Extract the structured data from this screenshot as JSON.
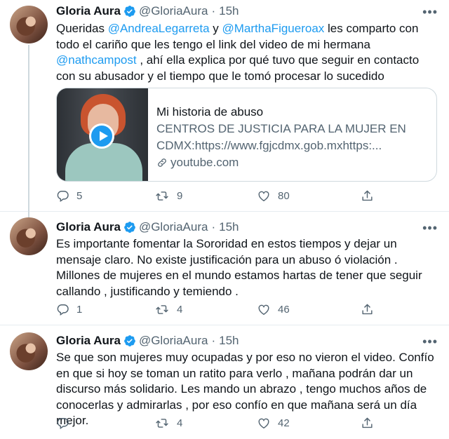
{
  "accent_color": "#1d9bf0",
  "tweets": [
    {
      "display_name": "Gloria Aura",
      "handle": "@GloriaAura",
      "separator": "·",
      "time": "15h",
      "text_segments": [
        {
          "type": "text",
          "value": "Queridas "
        },
        {
          "type": "mention",
          "value": "@AndreaLegarreta"
        },
        {
          "type": "text",
          "value": " y "
        },
        {
          "type": "mention",
          "value": "@MarthaFigueroax"
        },
        {
          "type": "text",
          "value": " les comparto con todo el cariño que les tengo el link del video de mi hermana "
        },
        {
          "type": "mention",
          "value": "@nathcampost"
        },
        {
          "type": "text",
          "value": " , ahí ella explica por qué tuvo que seguir en contacto con su abusador y el tiempo que le tomó procesar lo sucedido"
        }
      ],
      "card": {
        "title": "Mi historia de abuso",
        "description": "CENTROS DE JUSTICIA PARA LA MUJER EN CDMX:https://www.fgjcdmx.gob.mxhttps:...",
        "domain": "youtube.com"
      },
      "actions": {
        "reply": "5",
        "retweet": "9",
        "like": "80"
      }
    },
    {
      "display_name": "Gloria Aura",
      "handle": "@GloriaAura",
      "separator": "·",
      "time": "15h",
      "text": "Es importante fomentar la Sororidad en estos tiempos y dejar un mensaje claro. No existe justificación para un abuso ó violación . Millones de mujeres en el mundo estamos hartas de tener que seguir callando , justificando y temiendo .",
      "actions": {
        "reply": "1",
        "retweet": "4",
        "like": "46"
      }
    },
    {
      "display_name": "Gloria Aura",
      "handle": "@GloriaAura",
      "separator": "·",
      "time": "15h",
      "text": "Se que son mujeres muy ocupadas y por eso no vieron el video. Confío en que si hoy se toman un ratito para verlo , mañana podrán dar un discurso más solidario. Les mando un abrazo , tengo muchos años de conocerlas y admirarlas , por eso confío en que mañana será un día mejor.",
      "actions": {
        "reply": "",
        "retweet": "4",
        "like": "42"
      }
    }
  ],
  "icons": [
    "verified-badge-icon",
    "more-options-icon",
    "reply-icon",
    "retweet-icon",
    "like-icon",
    "share-icon",
    "link-icon",
    "play-icon"
  ]
}
